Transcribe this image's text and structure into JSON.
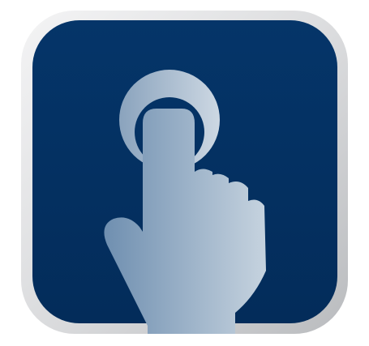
{
  "icon": {
    "name": "tap-hand-icon",
    "colors": {
      "frame_light": "#f4f4f5",
      "frame_mid": "#d9dadc",
      "frame_dark": "#b9bbbe",
      "tile_background": "#053569",
      "tile_background_edge": "#032c5a",
      "hand_dark": "#6f8fb0",
      "hand_light": "#c6d3df",
      "ring_dark": "#8aa3bd",
      "ring_light": "#cdd8e3"
    }
  }
}
